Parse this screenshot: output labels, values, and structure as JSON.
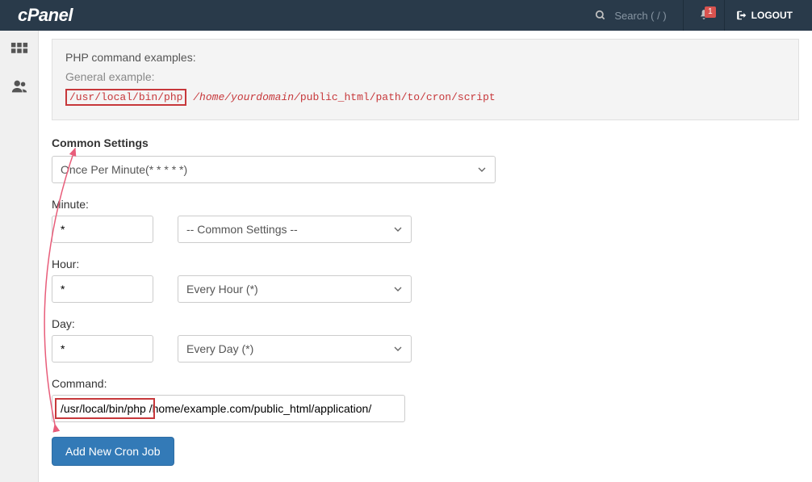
{
  "header": {
    "logo_text": "cPanel",
    "search_placeholder": "Search ( / )",
    "notification_count": "1",
    "logout_label": "LOGOUT"
  },
  "example": {
    "title": "PHP command examples:",
    "subtitle": "General example:",
    "bin": "/usr/local/bin/php",
    "home": "/home/yourdomain/",
    "path": "public_html/path/to/cron/script"
  },
  "form": {
    "common_settings_label": "Common Settings",
    "common_settings_value": "Once Per Minute(* * * * *)",
    "minute_label": "Minute:",
    "minute_value": "*",
    "minute_select": "-- Common Settings --",
    "hour_label": "Hour:",
    "hour_value": "*",
    "hour_select": "Every Hour (*)",
    "day_label": "Day:",
    "day_value": "*",
    "day_select": "Every Day (*)",
    "command_label": "Command:",
    "command_value": "/usr/local/bin/php /home/example.com/public_html/application/",
    "submit_label": "Add New Cron Job"
  }
}
